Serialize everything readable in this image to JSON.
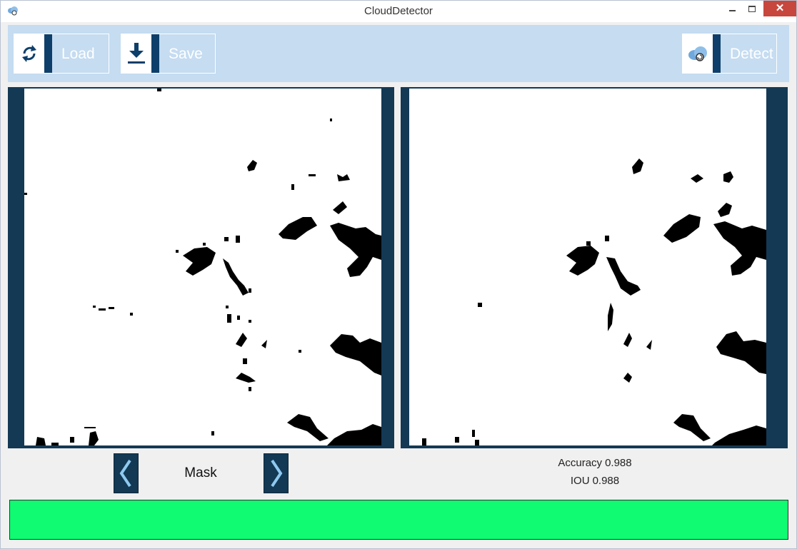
{
  "window": {
    "title": "CloudDetector",
    "close_glyph": "✕"
  },
  "icons": {
    "app": "cloud-app-icon",
    "load": "refresh-icon",
    "save": "download-icon",
    "detect": "cloud-refresh-icon",
    "prev": "chevron-left-icon",
    "next": "chevron-right-icon"
  },
  "toolbar": {
    "load_label": "Load",
    "save_label": "Save",
    "detect_label": "Detect"
  },
  "colors": {
    "toolbar_bg": "#c5dcf1",
    "accent": "#0e3f6a",
    "panel_bg": "#133954",
    "progress": "#10fb71"
  },
  "viewer": {
    "mode_label": "Mask"
  },
  "metrics": {
    "accuracy_label": "Accuracy",
    "accuracy_value": "0.988",
    "iou_label": "IOU",
    "iou_value": "0.988"
  },
  "progress": {
    "percent": 100
  }
}
